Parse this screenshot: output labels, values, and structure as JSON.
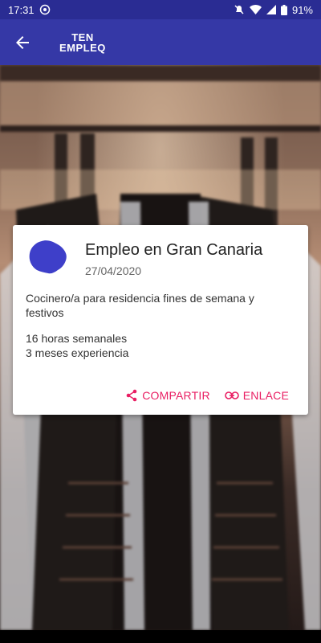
{
  "status": {
    "time": "17:31",
    "battery": "91%"
  },
  "app": {
    "logo_line1": "TEN",
    "logo_line2": "EMPLEQ"
  },
  "card": {
    "title": "Empleo en Gran Canaria",
    "date": "27/04/2020",
    "description": "Cocinero/a para residencia fines de semana y festivos",
    "details": [
      "16 horas semanales",
      "3 meses experiencia"
    ],
    "share_label": "COMPARTIR",
    "link_label": "ENLACE"
  },
  "colors": {
    "app_bar": "#3538A6",
    "accent": "#E91E63",
    "island": "#3E3FC9"
  }
}
